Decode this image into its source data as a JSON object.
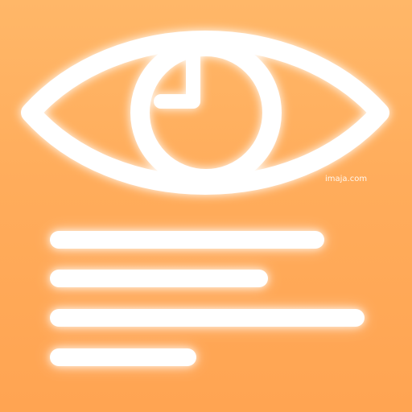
{
  "app_icon": {
    "name": "document-eye-clock-icon",
    "background_color": "#ffb061",
    "foreground_color": "#ffffff",
    "watermark_text": "imaja.com",
    "symbols": [
      "eye-icon",
      "clock-icon",
      "text-lines-icon"
    ],
    "text_lines_count": 4
  }
}
